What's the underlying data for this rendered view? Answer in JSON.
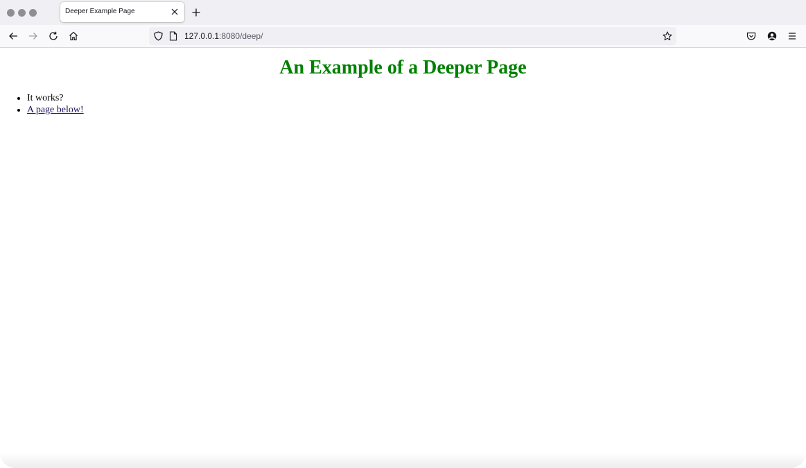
{
  "tab": {
    "title": "Deeper Example Page",
    "close_icon": "close-icon",
    "new_tab_icon": "plus-icon"
  },
  "nav": {
    "back_icon": "arrow-left-icon",
    "forward_icon": "arrow-right-icon",
    "reload_icon": "reload-icon",
    "home_icon": "home-icon",
    "url_host": "127.0.0.1",
    "url_rest": ":8080/deep/",
    "shield_icon": "shield-icon",
    "page_icon": "page-icon",
    "bookmark_icon": "star-icon",
    "pocket_icon": "pocket-icon",
    "account_icon": "account-icon",
    "menu_icon": "hamburger-menu-icon"
  },
  "page": {
    "heading": "An Example of a Deeper Page",
    "heading_color": "#008000",
    "items": [
      {
        "text": "It works?"
      },
      {
        "text": "A page below!",
        "is_link": true
      }
    ]
  }
}
